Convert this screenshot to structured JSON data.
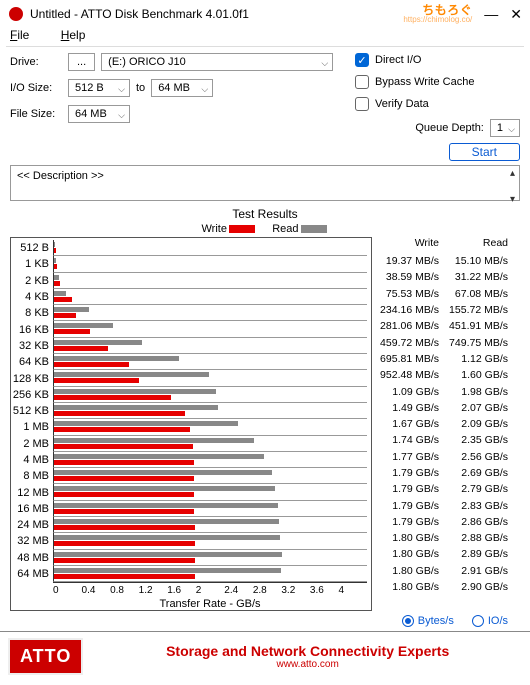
{
  "window": {
    "title": "Untitled - ATTO Disk Benchmark 4.01.0f1"
  },
  "brand_watermark": {
    "text": "ちもろぐ",
    "sub": "https://chimolog.co/"
  },
  "menu": {
    "file": "File",
    "help": "Help"
  },
  "controls": {
    "drive_label": "Drive:",
    "drive_button": "...",
    "drive_value": "(E:) ORICO J10",
    "io_label": "I/O Size:",
    "io_from": "512 B",
    "io_to_label": "to",
    "io_to": "64 MB",
    "file_label": "File Size:",
    "file_value": "64 MB",
    "direct_io": "Direct I/O",
    "bypass": "Bypass Write Cache",
    "verify": "Verify Data",
    "queue_label": "Queue Depth:",
    "queue_value": "1",
    "start": "Start"
  },
  "description": {
    "label": "<< Description >>"
  },
  "results_header": "Test Results",
  "legend": {
    "write": "Write",
    "read": "Read"
  },
  "xaxis_label": "Transfer Rate - GB/s",
  "chart_data": {
    "type": "bar",
    "xlim": [
      0,
      4
    ],
    "xticks": [
      0,
      0.4,
      0.8,
      1.2,
      1.6,
      2,
      2.4,
      2.8,
      3.2,
      3.6,
      4
    ],
    "categories": [
      "512 B",
      "1 KB",
      "2 KB",
      "4 KB",
      "8 KB",
      "16 KB",
      "32 KB",
      "64 KB",
      "128 KB",
      "256 KB",
      "512 KB",
      "1 MB",
      "2 MB",
      "4 MB",
      "8 MB",
      "12 MB",
      "16 MB",
      "24 MB",
      "32 MB",
      "48 MB",
      "64 MB"
    ],
    "series": [
      {
        "name": "Write",
        "color": "#e60000",
        "values_gbps": [
          0.01937,
          0.03859,
          0.07553,
          0.23416,
          0.28106,
          0.45972,
          0.69581,
          0.95248,
          1.09,
          1.49,
          1.67,
          1.74,
          1.77,
          1.79,
          1.79,
          1.79,
          1.79,
          1.8,
          1.8,
          1.8,
          1.8
        ],
        "display": [
          "19.37 MB/s",
          "38.59 MB/s",
          "75.53 MB/s",
          "234.16 MB/s",
          "281.06 MB/s",
          "459.72 MB/s",
          "695.81 MB/s",
          "952.48 MB/s",
          "1.09 GB/s",
          "1.49 GB/s",
          "1.67 GB/s",
          "1.74 GB/s",
          "1.77 GB/s",
          "1.79 GB/s",
          "1.79 GB/s",
          "1.79 GB/s",
          "1.79 GB/s",
          "1.80 GB/s",
          "1.80 GB/s",
          "1.80 GB/s",
          "1.80 GB/s"
        ]
      },
      {
        "name": "Read",
        "color": "#888888",
        "values_gbps": [
          0.0151,
          0.03122,
          0.06708,
          0.15572,
          0.45191,
          0.74975,
          1.12,
          1.6,
          1.98,
          2.07,
          2.09,
          2.35,
          2.56,
          2.69,
          2.79,
          2.83,
          2.86,
          2.88,
          2.89,
          2.91,
          2.9
        ],
        "display": [
          "15.10 MB/s",
          "31.22 MB/s",
          "67.08 MB/s",
          "155.72 MB/s",
          "451.91 MB/s",
          "749.75 MB/s",
          "1.12 GB/s",
          "1.60 GB/s",
          "1.98 GB/s",
          "2.07 GB/s",
          "2.09 GB/s",
          "2.35 GB/s",
          "2.56 GB/s",
          "2.69 GB/s",
          "2.79 GB/s",
          "2.83 GB/s",
          "2.86 GB/s",
          "2.88 GB/s",
          "2.89 GB/s",
          "2.91 GB/s",
          "2.90 GB/s"
        ]
      }
    ]
  },
  "units": {
    "bytes": "Bytes/s",
    "io": "IO/s"
  },
  "footer": {
    "logo": "ATTO",
    "line1": "Storage and Network Connectivity Experts",
    "line2": "www.atto.com"
  }
}
